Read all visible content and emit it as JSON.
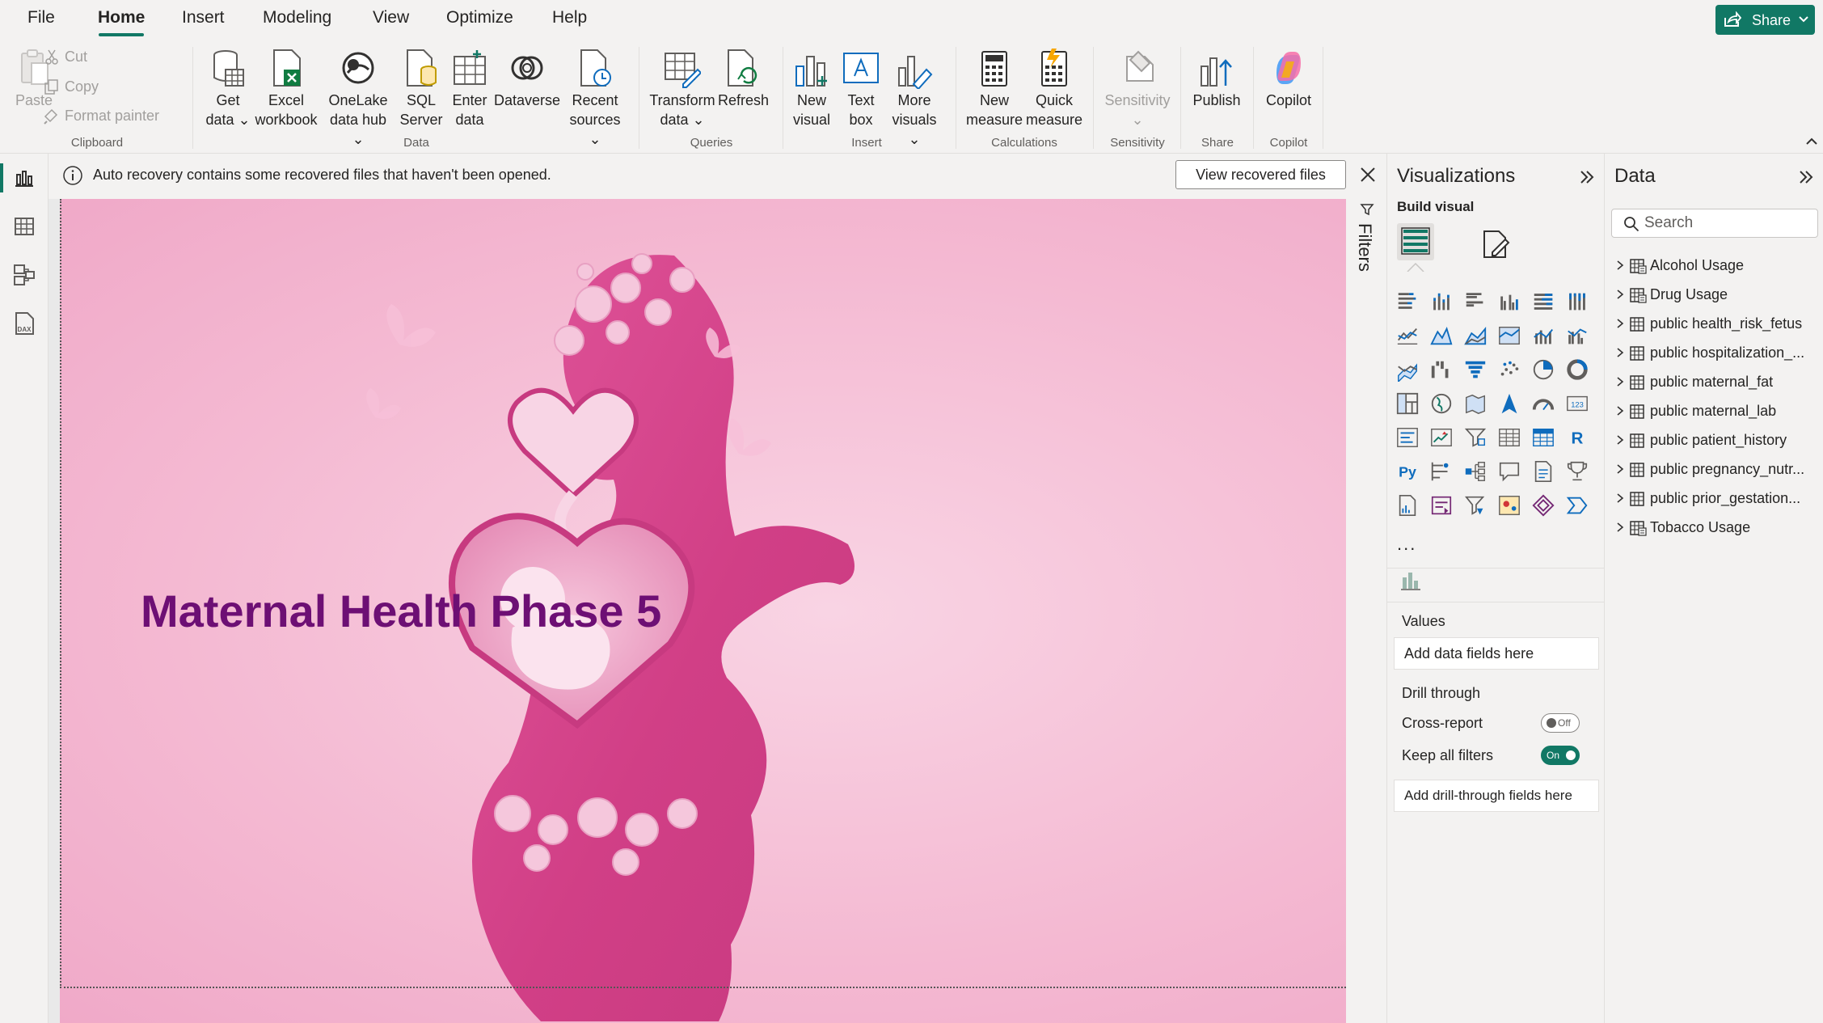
{
  "menu": {
    "tabs": [
      "File",
      "Home",
      "Insert",
      "Modeling",
      "View",
      "Optimize",
      "Help"
    ],
    "active_tab": "Home",
    "share_label": "Share"
  },
  "ribbon": {
    "clipboard": {
      "paste": "Paste",
      "cut": "Cut",
      "copy": "Copy",
      "format_painter": "Format painter",
      "group": "Clipboard"
    },
    "data": {
      "get_data": [
        "Get",
        "data ⌄"
      ],
      "excel": [
        "Excel",
        "workbook"
      ],
      "onelake": [
        "OneLake",
        "data hub ⌄"
      ],
      "sql": [
        "SQL",
        "Server"
      ],
      "enter": [
        "Enter",
        "data"
      ],
      "dataverse": "Dataverse",
      "recent": [
        "Recent",
        "sources ⌄"
      ],
      "group": "Data"
    },
    "queries": {
      "transform": [
        "Transform",
        "data ⌄"
      ],
      "refresh": "Refresh",
      "group": "Queries"
    },
    "insert": {
      "new_visual": [
        "New",
        "visual"
      ],
      "text_box": [
        "Text",
        "box"
      ],
      "more_visuals": [
        "More",
        "visuals ⌄"
      ],
      "group": "Insert"
    },
    "calculations": {
      "new_measure": [
        "New",
        "measure"
      ],
      "quick_measure": [
        "Quick",
        "measure"
      ],
      "group": "Calculations"
    },
    "sensitivity": {
      "label": "Sensitivity",
      "caret": "⌄",
      "group": "Sensitivity"
    },
    "share": {
      "publish": "Publish",
      "group": "Share"
    },
    "copilot": {
      "label": "Copilot",
      "group": "Copilot"
    }
  },
  "infobar": {
    "message": "Auto recovery contains some recovered files that haven't been opened.",
    "button": "View recovered files"
  },
  "canvas": {
    "title": "Maternal Health Phase 5",
    "title_color": "#6d0f74"
  },
  "filters": {
    "label": "Filters"
  },
  "visualizations": {
    "title": "Visualizations",
    "build_visual": "Build visual",
    "more": "...",
    "values_label": "Values",
    "values_placeholder": "Add data fields here",
    "drill_through": "Drill through",
    "cross_report": "Cross-report",
    "cross_report_state": "Off",
    "keep_all_filters": "Keep all filters",
    "keep_all_filters_state": "On",
    "drill_placeholder": "Add drill-through fields here",
    "icons": [
      "stacked-bar-chart",
      "stacked-column-chart",
      "clustered-bar-chart",
      "clustered-column-chart",
      "100-stacked-bar-chart",
      "100-stacked-column-chart",
      "line-chart",
      "area-chart",
      "stacked-area-chart",
      "100-stacked-area-chart",
      "line-and-stacked-column-chart",
      "line-and-clustered-column-chart",
      "ribbon-chart",
      "waterfall-chart",
      "funnel-chart",
      "scatter-chart",
      "pie-chart",
      "donut-chart",
      "treemap",
      "map",
      "filled-map",
      "azure-map",
      "gauge",
      "card",
      "multi-row-card",
      "kpi",
      "slicer",
      "table",
      "matrix",
      "r-script-visual",
      "python-visual",
      "key-influencers",
      "decomposition-tree",
      "qna",
      "smart-narrative",
      "metrics",
      "paginated-report",
      "power-apps",
      "power-automate",
      "arcgis-map",
      "diamond-visual",
      "chevron-visual"
    ]
  },
  "data_pane": {
    "title": "Data",
    "search_placeholder": "Search",
    "tables": [
      "Alcohol Usage",
      "Drug Usage",
      "public health_risk_fetus",
      "public hospitalization_...",
      "public maternal_fat",
      "public maternal_lab",
      "public patient_history",
      "public pregnancy_nutr...",
      "public prior_gestation...",
      "Tobacco Usage"
    ]
  },
  "colors": {
    "accent": "#117865",
    "canvas_pink": "#f4b9d2",
    "figure_pink": "#d94a8c"
  }
}
